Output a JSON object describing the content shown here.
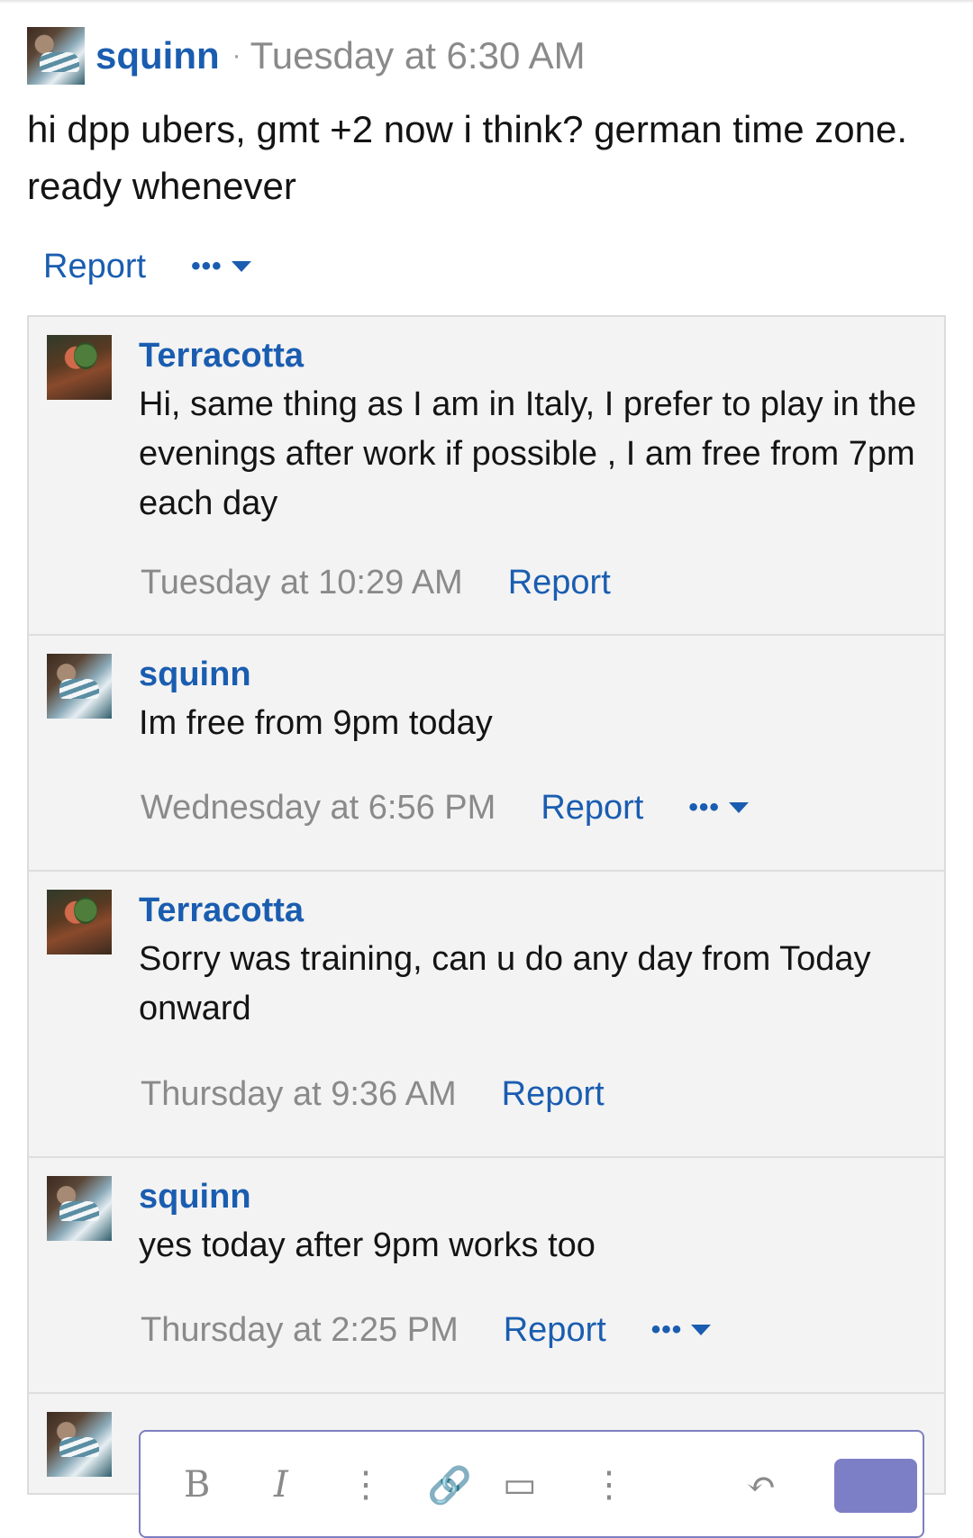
{
  "post": {
    "author": "squinn",
    "separator": "·",
    "time": "Tuesday at 6:30 AM",
    "body": "hi dpp ubers, gmt +2 now i think? german time zone. ready whenever",
    "report_label": "Report",
    "more_label": "•••"
  },
  "comments": [
    {
      "author": "Terracotta",
      "body": "Hi, same thing as I am in Italy, I prefer to play in the evenings after work if possible , I am free from 7pm each day",
      "time": "Tuesday at 10:29 AM",
      "report_label": "Report"
    },
    {
      "author": "squinn",
      "body": "Im free from 9pm today",
      "time": "Wednesday at 6:56 PM",
      "report_label": "Report",
      "more_label": "•••"
    },
    {
      "author": "Terracotta",
      "body": "Sorry was training, can u do any day from Today onward",
      "time": "Thursday at 9:36 AM",
      "report_label": "Report"
    },
    {
      "author": "squinn",
      "body": "yes today after 9pm works too",
      "time": "Thursday at 2:25 PM",
      "report_label": "Report",
      "more_label": "•••"
    }
  ],
  "editor": {
    "tools": [
      "B",
      "I",
      "⋮",
      "🔗",
      "▭",
      "⋮",
      "↶"
    ]
  },
  "colors": {
    "link": "#1a5db0",
    "muted": "#8a8a8a",
    "panel": "#f3f3f3",
    "editor_border": "#7e7fbf",
    "send_button": "#7d7fc6"
  },
  "icons": [
    "avatar-squinn",
    "avatar-terracotta",
    "more-dots-icon",
    "chevron-down-icon"
  ]
}
